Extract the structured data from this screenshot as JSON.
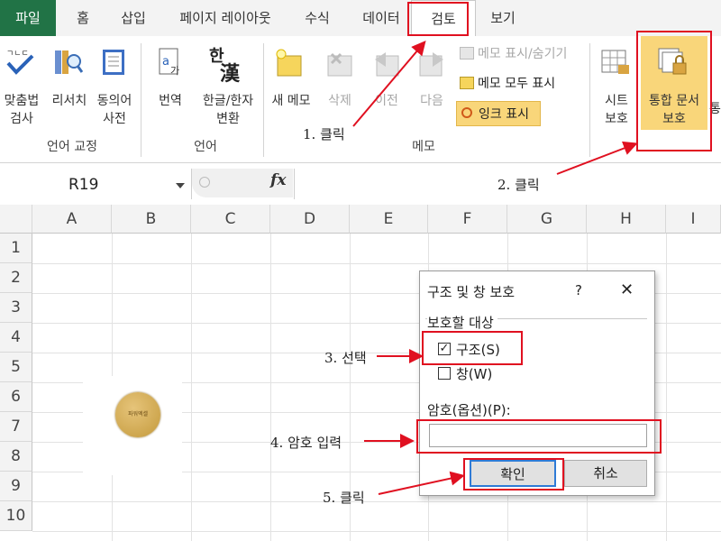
{
  "tabs": [
    {
      "label": "파일"
    },
    {
      "label": "홈"
    },
    {
      "label": "삽입"
    },
    {
      "label": "페이지 레이아웃"
    },
    {
      "label": "수식"
    },
    {
      "label": "데이터"
    },
    {
      "label": "검토"
    },
    {
      "label": "보기"
    }
  ],
  "ribbon": {
    "lang_proof": {
      "group_label": "언어 교정",
      "spell_check": "맞춤법\n검사",
      "research": "리서치",
      "thesaurus": "동의어\n사전"
    },
    "language": {
      "group_label": "언어",
      "translate": "번역",
      "hanja": "한글/한자\n변환",
      "hanja_glyph_top": "한",
      "hanja_glyph_bottom": "漢"
    },
    "memo": {
      "group_label": "메모",
      "new_memo": "새 메모",
      "delete": "삭제",
      "prev": "이전",
      "next": "다음",
      "show_hide": "메모 표시/숨기기",
      "show_all": "메모 모두 표시",
      "show_ink": "잉크 표시"
    },
    "changes": {
      "protect_sheet": "시트\n보호",
      "protect_workbook": "통합 문서\n보호",
      "cut_label": "통"
    }
  },
  "formula_bar": {
    "name_box": "R19",
    "fx": "fx",
    "formula": ""
  },
  "grid": {
    "columns": [
      "A",
      "B",
      "C",
      "D",
      "E",
      "F",
      "G",
      "H",
      "I"
    ],
    "rows": [
      "1",
      "2",
      "3",
      "4",
      "5",
      "6",
      "7",
      "8",
      "9",
      "10"
    ],
    "stamp_text": "파워엑셀"
  },
  "dialog": {
    "title": "구조 및 창 보호",
    "help": "?",
    "close": "✕",
    "section_label": "보호할 대상",
    "structure_label": "구조(S)",
    "structure_checked": true,
    "window_label": "창(W)",
    "window_checked": false,
    "password_label": "암호(옵션)(P):",
    "password_value": "",
    "ok": "확인",
    "cancel": "취소"
  },
  "annotations": {
    "step1": "1. 클릭",
    "step2": "2. 클릭",
    "step3": "3. 선택",
    "step4": "4. 암호 입력",
    "step5": "5. 클릭"
  },
  "colors": {
    "file_tab": "#217346",
    "highlight": "#f9d67a",
    "annotation_red": "#e01020"
  }
}
